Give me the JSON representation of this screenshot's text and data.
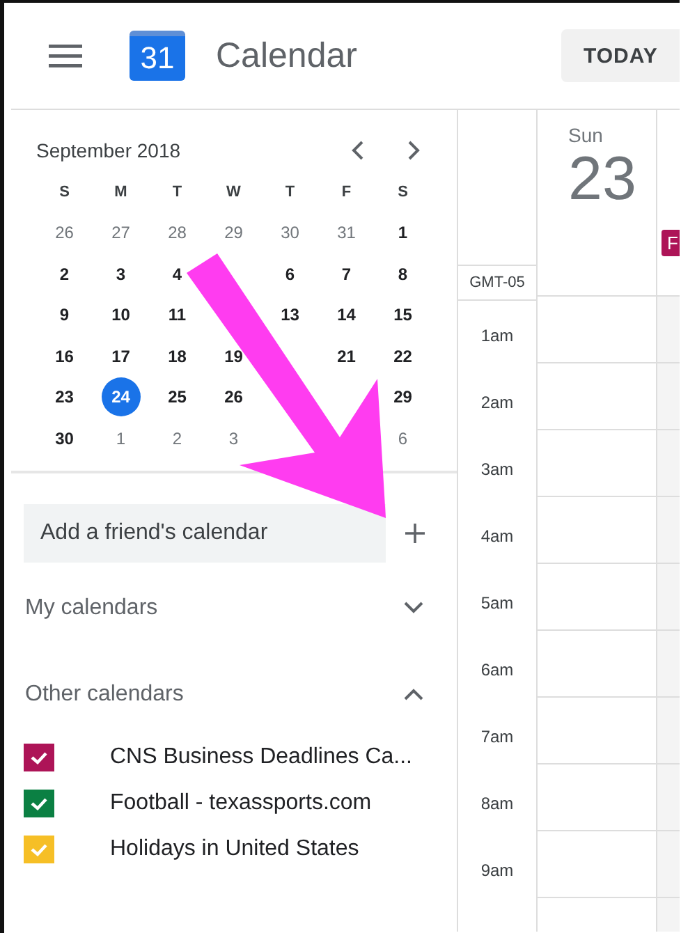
{
  "header": {
    "logo_text": "31",
    "app_title": "Calendar",
    "today_button": "TODAY"
  },
  "mini_calendar": {
    "month": "September 2018",
    "weekdays": [
      "S",
      "M",
      "T",
      "W",
      "T",
      "F",
      "S"
    ],
    "weeks": [
      [
        {
          "day": "26",
          "muted": true,
          "selected": false
        },
        {
          "day": "27",
          "muted": true,
          "selected": false
        },
        {
          "day": "28",
          "muted": true,
          "selected": false
        },
        {
          "day": "29",
          "muted": true,
          "selected": false
        },
        {
          "day": "30",
          "muted": true,
          "selected": false
        },
        {
          "day": "31",
          "muted": true,
          "selected": false
        },
        {
          "day": "1",
          "muted": false,
          "selected": false
        }
      ],
      [
        {
          "day": "2",
          "muted": false,
          "selected": false
        },
        {
          "day": "3",
          "muted": false,
          "selected": false
        },
        {
          "day": "4",
          "muted": false,
          "selected": false
        },
        {
          "covered": true
        },
        {
          "day": "6",
          "muted": false,
          "selected": false
        },
        {
          "day": "7",
          "muted": false,
          "selected": false
        },
        {
          "day": "8",
          "muted": false,
          "selected": false
        }
      ],
      [
        {
          "day": "9",
          "muted": false,
          "selected": false
        },
        {
          "day": "10",
          "muted": false,
          "selected": false
        },
        {
          "day": "11",
          "muted": false,
          "selected": false
        },
        {
          "covered": true
        },
        {
          "day": "13",
          "muted": false,
          "selected": false
        },
        {
          "day": "14",
          "muted": false,
          "selected": false
        },
        {
          "day": "15",
          "muted": false,
          "selected": false
        }
      ],
      [
        {
          "day": "16",
          "muted": false,
          "selected": false
        },
        {
          "day": "17",
          "muted": false,
          "selected": false
        },
        {
          "day": "18",
          "muted": false,
          "selected": false
        },
        {
          "day": "19",
          "muted": false,
          "selected": false
        },
        {
          "covered": true
        },
        {
          "day": "21",
          "muted": false,
          "selected": false
        },
        {
          "day": "22",
          "muted": false,
          "selected": false
        }
      ],
      [
        {
          "day": "23",
          "muted": false,
          "selected": false
        },
        {
          "day": "24",
          "muted": false,
          "selected": true
        },
        {
          "day": "25",
          "muted": false,
          "selected": false
        },
        {
          "day": "26",
          "muted": false,
          "selected": false
        },
        {
          "covered": true
        },
        {
          "covered": true
        },
        {
          "day": "29",
          "muted": false,
          "selected": false
        }
      ],
      [
        {
          "day": "30",
          "muted": false,
          "selected": false
        },
        {
          "day": "1",
          "muted": true,
          "selected": false
        },
        {
          "day": "2",
          "muted": true,
          "selected": false
        },
        {
          "day": "3",
          "muted": true,
          "selected": false
        },
        {
          "covered": true
        },
        {
          "covered": true
        },
        {
          "day": "6",
          "muted": true,
          "selected": false
        }
      ]
    ]
  },
  "add_friend": {
    "placeholder": "Add a friend's calendar"
  },
  "sections": [
    {
      "title": "My calendars",
      "expanded": false
    },
    {
      "title": "Other calendars",
      "expanded": true,
      "calendars": [
        {
          "name": "CNS Business Deadlines Ca...",
          "checked": true,
          "color": "#ad1457"
        },
        {
          "name": "Football - texassports.com",
          "checked": true,
          "color": "#0b8043"
        },
        {
          "name": "Holidays in United States",
          "checked": true,
          "color": "#f6bf26"
        }
      ]
    }
  ],
  "day_view": {
    "weekday": "Sun",
    "date": "23",
    "timezone": "GMT-05",
    "event_chip": "F",
    "hours": [
      "1am",
      "2am",
      "3am",
      "4am",
      "5am",
      "6am",
      "7am",
      "8am",
      "9am"
    ]
  }
}
